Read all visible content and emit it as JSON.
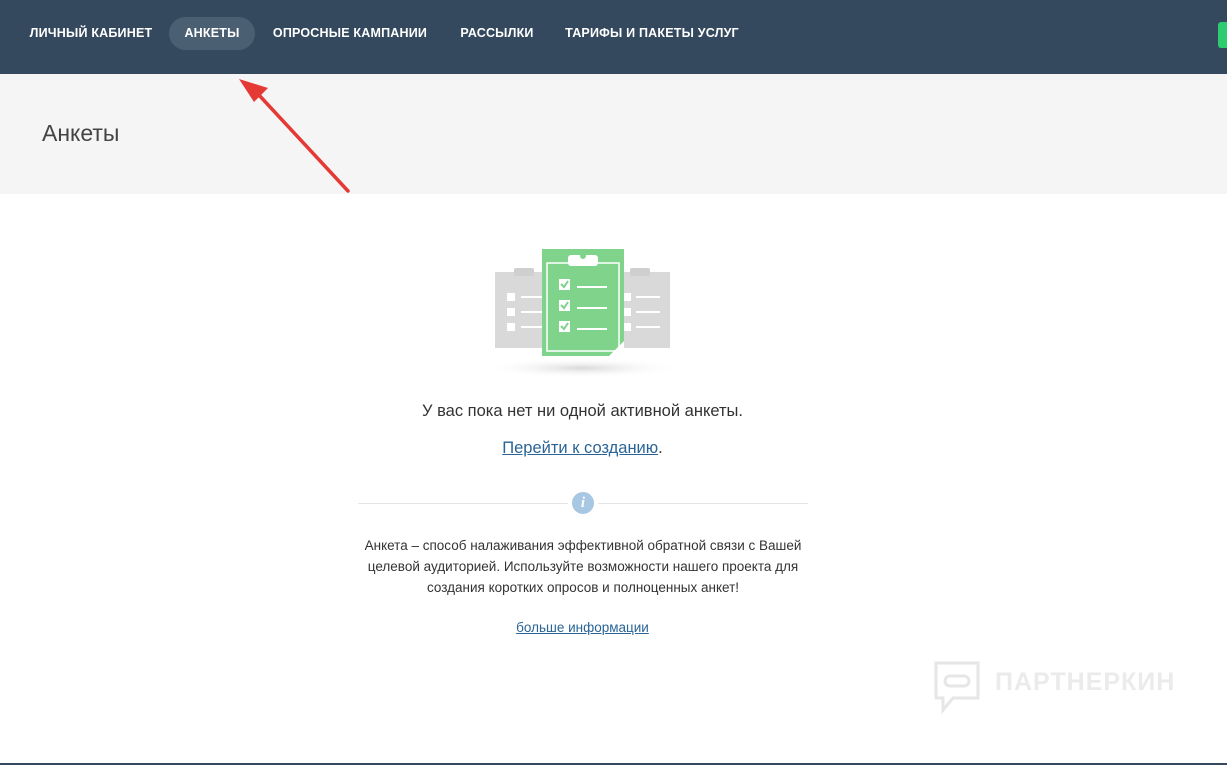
{
  "nav": {
    "items": [
      {
        "label": "ЛИЧНЫЙ КАБИНЕТ",
        "active": false
      },
      {
        "label": "АНКЕТЫ",
        "active": true
      },
      {
        "label": "ОПРОСНЫЕ КАМПАНИИ",
        "active": false
      },
      {
        "label": "РАССЫЛКИ",
        "active": false
      },
      {
        "label": "ТАРИФЫ И ПАКЕТЫ УСЛУГ",
        "active": false
      }
    ]
  },
  "page": {
    "title": "Анкеты"
  },
  "empty_state": {
    "message": "У вас пока нет ни одной активной анкеты.",
    "create_link": "Перейти к созданию",
    "create_suffix": "."
  },
  "info": {
    "icon_letter": "i",
    "text": "Анкета – способ налаживания эффективной обратной связи с Вашей целевой аудиторией. Используйте возможности нашего проекта для создания коротких опросов и полноценных анкет!",
    "more_link": "больше информации"
  },
  "watermark": {
    "text": "ПАРТНЕРКИН"
  },
  "colors": {
    "nav_bg": "#34495e",
    "accent_green": "#7fd38b",
    "link": "#2a6496",
    "annotation_arrow": "#e53935"
  }
}
